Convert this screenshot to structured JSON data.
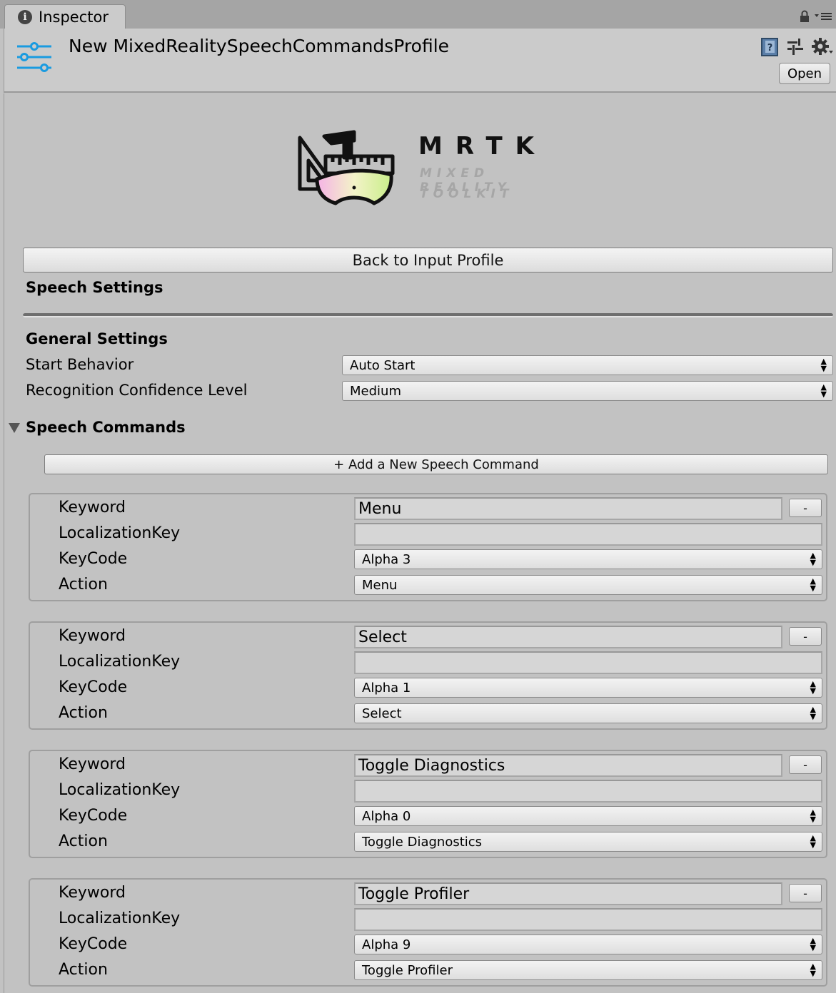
{
  "tab": {
    "title": "Inspector"
  },
  "header": {
    "title": "New MixedRealitySpeechCommandsProfile",
    "open_label": "Open"
  },
  "logo": {
    "word": "MRTK",
    "sub1": "MIXED REALITY",
    "sub2": "TOOLKIT"
  },
  "back_button": "Back to Input Profile",
  "speech_settings_heading": "Speech Settings",
  "general": {
    "heading": "General Settings",
    "start_behavior": {
      "label": "Start Behavior",
      "value": "Auto Start"
    },
    "confidence": {
      "label": "Recognition Confidence Level",
      "value": "Medium"
    }
  },
  "commands": {
    "heading": "Speech Commands",
    "add_label": "+ Add a New Speech Command",
    "field_labels": {
      "keyword": "Keyword",
      "localization": "LocalizationKey",
      "keycode": "KeyCode",
      "action": "Action"
    },
    "remove_label": "-",
    "items": [
      {
        "keyword": "Menu",
        "localization_key": "",
        "keycode": "Alpha 3",
        "action": "Menu"
      },
      {
        "keyword": "Select",
        "localization_key": "",
        "keycode": "Alpha 1",
        "action": "Select"
      },
      {
        "keyword": "Toggle Diagnostics",
        "localization_key": "",
        "keycode": "Alpha 0",
        "action": "Toggle Diagnostics"
      },
      {
        "keyword": "Toggle Profiler",
        "localization_key": "",
        "keycode": "Alpha 9",
        "action": "Toggle Profiler"
      }
    ]
  }
}
